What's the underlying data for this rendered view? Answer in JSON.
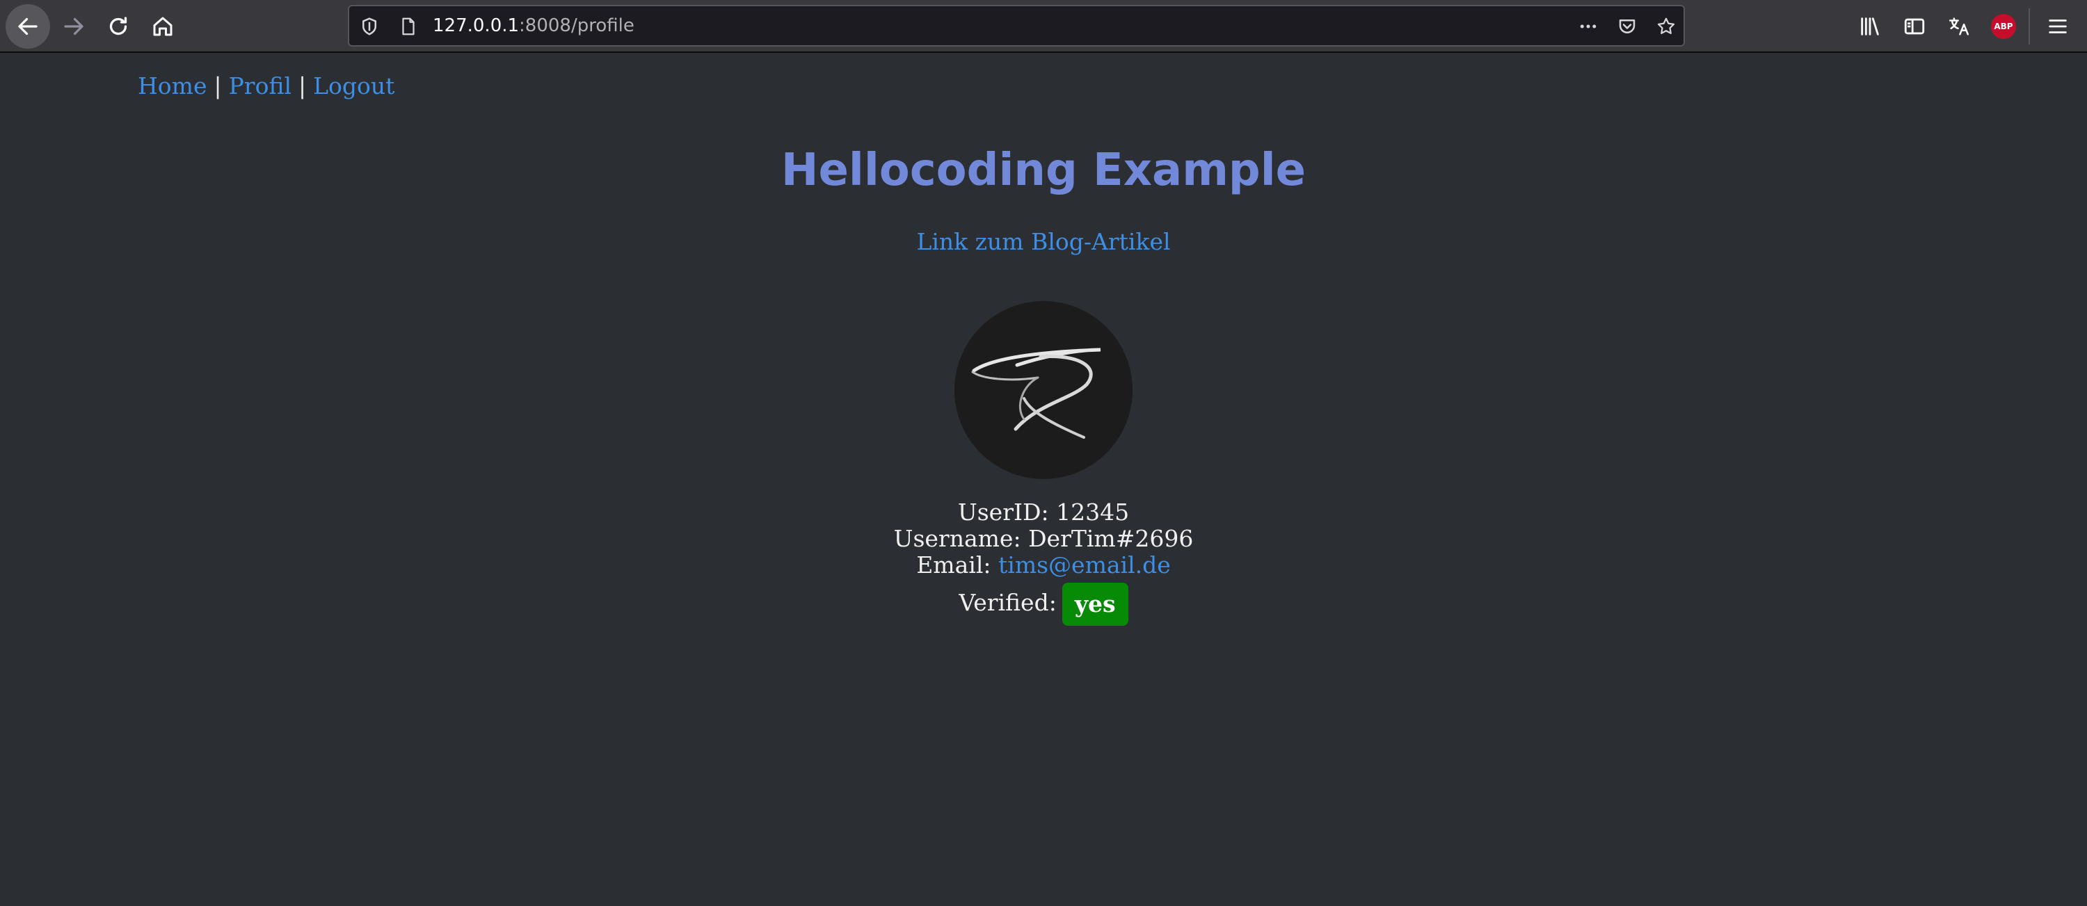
{
  "browser": {
    "url_host": "127.0.0.1",
    "url_rest": ":8008/profile",
    "icons": {
      "back": "back-arrow-icon",
      "forward": "forward-arrow-icon",
      "reload": "reload-icon",
      "home": "home-icon",
      "tracking": "shield-icon",
      "page": "page-icon",
      "more": "more-dots-icon",
      "pocket": "pocket-icon",
      "bookmark": "star-icon",
      "library": "library-icon",
      "sidebar": "sidebar-icon",
      "translate": "translate-icon",
      "menu": "hamburger-menu-icon"
    },
    "abp_label": "ABP"
  },
  "nav": {
    "home": "Home",
    "separator": "|",
    "profile": "Profil",
    "logout": "Logout"
  },
  "page": {
    "title": "Hellocoding Example",
    "blog_link": "Link zum Blog-Artikel"
  },
  "profile": {
    "avatar_icon": "signature-logo",
    "userid_label": "UserID:",
    "userid": "12345",
    "username_label": "Username:",
    "username": "DerTim#2696",
    "email_label": "Email:",
    "email": "tims@email.de",
    "verified_label": "Verified:",
    "verified": "yes"
  },
  "colors": {
    "background": "#2b2e33",
    "title": "#7289da",
    "link": "#3d8fe6",
    "verified_badge": "#078b07"
  }
}
